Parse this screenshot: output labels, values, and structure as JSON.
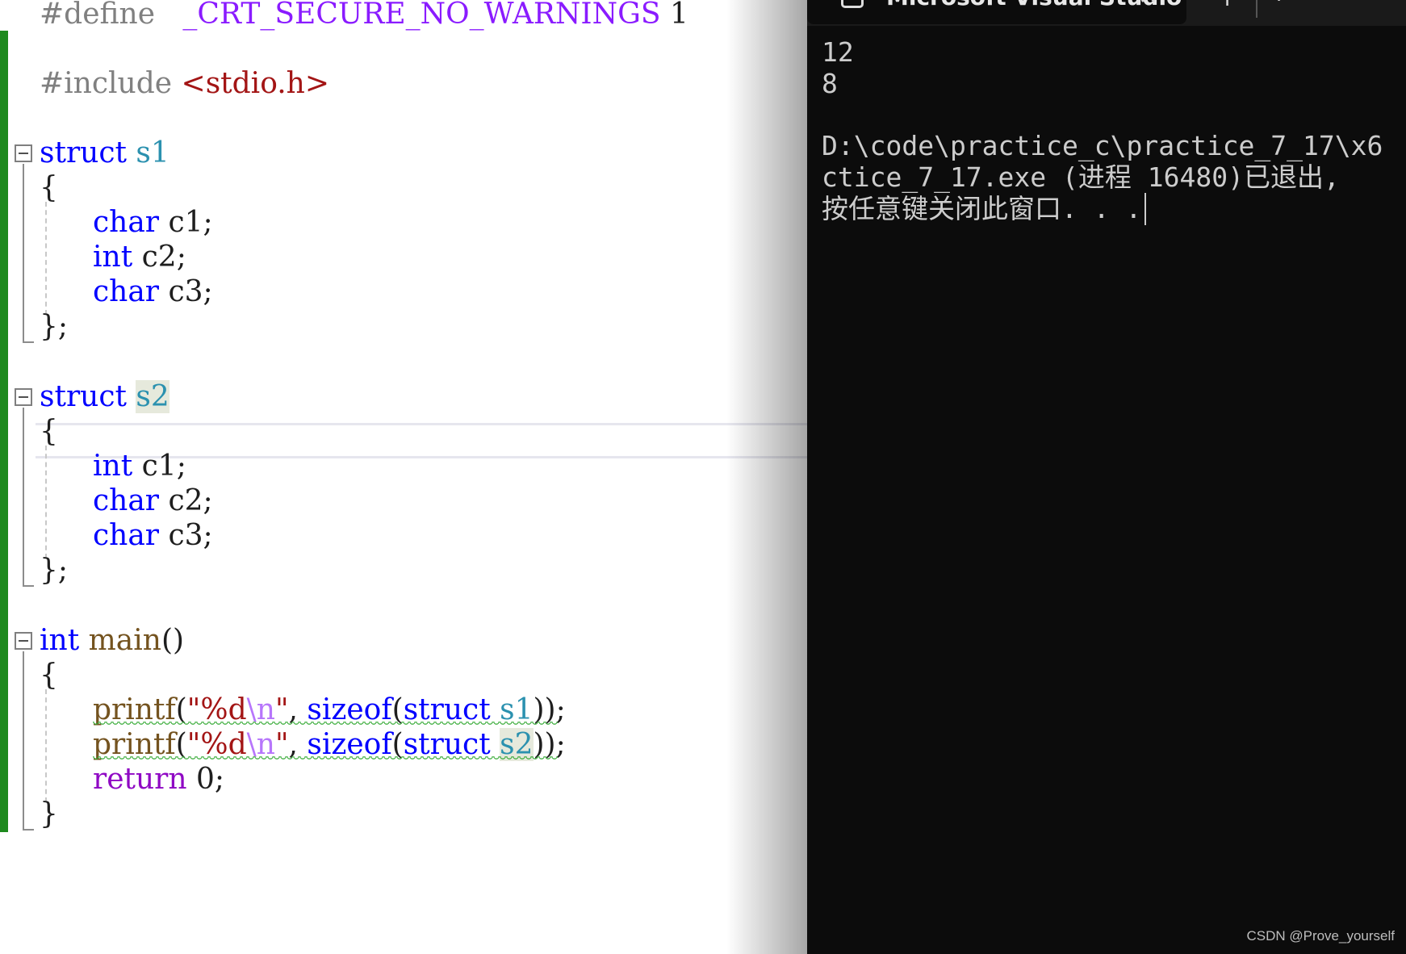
{
  "editor": {
    "line_define": {
      "kw": "#define",
      "macro": "_CRT_SECURE_NO_WARNINGS",
      "val": "1"
    },
    "line_include": {
      "kw": "#include",
      "file": "<stdio.h>"
    },
    "struct1": {
      "kw": "struct",
      "name": "s1",
      "open": "{",
      "close": "};",
      "members": [
        {
          "type": "char",
          "name": "c1;"
        },
        {
          "type": "int",
          "name": "c2;"
        },
        {
          "type": "char",
          "name": "c3;"
        }
      ]
    },
    "struct2": {
      "kw": "struct",
      "name": "s2",
      "open": "{",
      "close": "};",
      "members": [
        {
          "type": "int",
          "name": "c1;"
        },
        {
          "type": "char",
          "name": "c2;"
        },
        {
          "type": "char",
          "name": "c3;"
        }
      ]
    },
    "main": {
      "type": "int",
      "name": "main",
      "parens": "()",
      "open": "{",
      "close": "}",
      "printf1": {
        "fn": "printf",
        "p1": "(",
        "str_open": "\"%d",
        "esc": "\\n",
        "str_close": "\"",
        "comma": ", ",
        "sizeof": "sizeof",
        "p2": "(",
        "kw": "struct",
        "type": "s1",
        "end": "));"
      },
      "printf2": {
        "fn": "printf",
        "p1": "(",
        "str_open": "\"%d",
        "esc": "\\n",
        "str_close": "\"",
        "comma": ", ",
        "sizeof": "sizeof",
        "p2": "(",
        "kw": "struct",
        "type": "s2",
        "end": "));"
      },
      "ret": {
        "kw": "return",
        "val": "0;"
      }
    }
  },
  "console": {
    "tab_title": "Microsoft Visual Studio",
    "tab_close": "✕",
    "tab_new": "+",
    "tab_menu": "⌄",
    "output": [
      "12",
      "8",
      "",
      "D:\\code\\practice_c\\practice_7_17\\x6",
      "ctice_7_17.exe (进程 16480)已退出,",
      "按任意键关闭此窗口. . ."
    ]
  },
  "watermark": "CSDN @Prove_yourself",
  "colors": {
    "keyword": "#0000ff",
    "type": "#2b91af",
    "string": "#a31515",
    "macro": "#8a1bff",
    "console_bg": "#0c0c0c",
    "change_bar": "#1e8a1e"
  }
}
